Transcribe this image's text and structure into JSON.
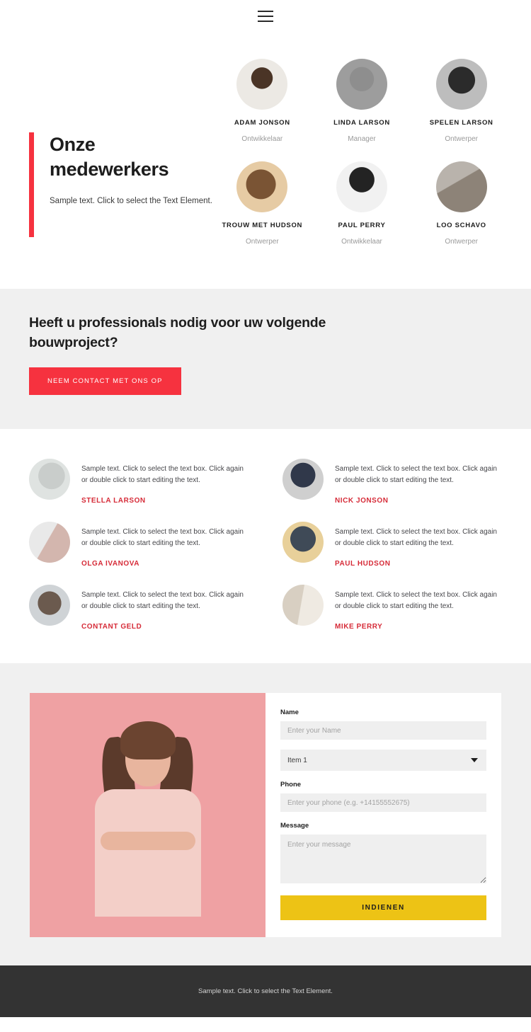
{
  "header": {
    "menu_icon": "hamburger-menu-icon"
  },
  "team": {
    "title_line1": "Onze",
    "title_line2": "medewerkers",
    "subtitle": "Sample text. Click to select the Text Element.",
    "accent_color": "#f6323f",
    "members": [
      {
        "name": "ADAM JONSON",
        "role": "Ontwikkelaar"
      },
      {
        "name": "LINDA LARSON",
        "role": "Manager"
      },
      {
        "name": "SPELEN LARSON",
        "role": "Ontwerper"
      },
      {
        "name": "TROUW MET HUDSON",
        "role": "Ontwerper"
      },
      {
        "name": "PAUL PERRY",
        "role": "Ontwikkelaar"
      },
      {
        "name": "LOO SCHAVO",
        "role": "Ontwerper"
      }
    ]
  },
  "cta": {
    "title": "Heeft u professionals nodig voor uw volgende bouwproject?",
    "button_label": "NEEM CONTACT MET ONS OP",
    "button_color": "#f6323f",
    "background_color": "#f0f0f0"
  },
  "testimonials": {
    "name_color": "#d62b38",
    "items": [
      {
        "text": "Sample text. Click to select the text box. Click again or double click to start editing the text.",
        "name": "STELLA LARSON"
      },
      {
        "text": "Sample text. Click to select the text box. Click again or double click to start editing the text.",
        "name": "NICK JONSON"
      },
      {
        "text": "Sample text. Click to select the text box. Click again or double click to start editing the text.",
        "name": "OLGA IVANOVA"
      },
      {
        "text": "Sample text. Click to select the text box. Click again or double click to start editing the text.",
        "name": "PAUL HUDSON"
      },
      {
        "text": "Sample text. Click to select the text box. Click again or double click to start editing the text.",
        "name": "CONTANT GELD"
      },
      {
        "text": "Sample text. Click to select the text box. Click again or double click to start editing the text.",
        "name": "MIKE PERRY"
      }
    ]
  },
  "contact": {
    "name_label": "Name",
    "name_placeholder": "Enter your Name",
    "select_value": "Item 1",
    "select_options": [
      "Item 1"
    ],
    "phone_label": "Phone",
    "phone_placeholder": "Enter your phone (e.g. +14155552675)",
    "message_label": "Message",
    "message_placeholder": "Enter your message",
    "submit_label": "INDIENEN",
    "submit_color": "#edc315"
  },
  "footer": {
    "text": "Sample text. Click to select the Text Element.",
    "background_color": "#333333"
  }
}
